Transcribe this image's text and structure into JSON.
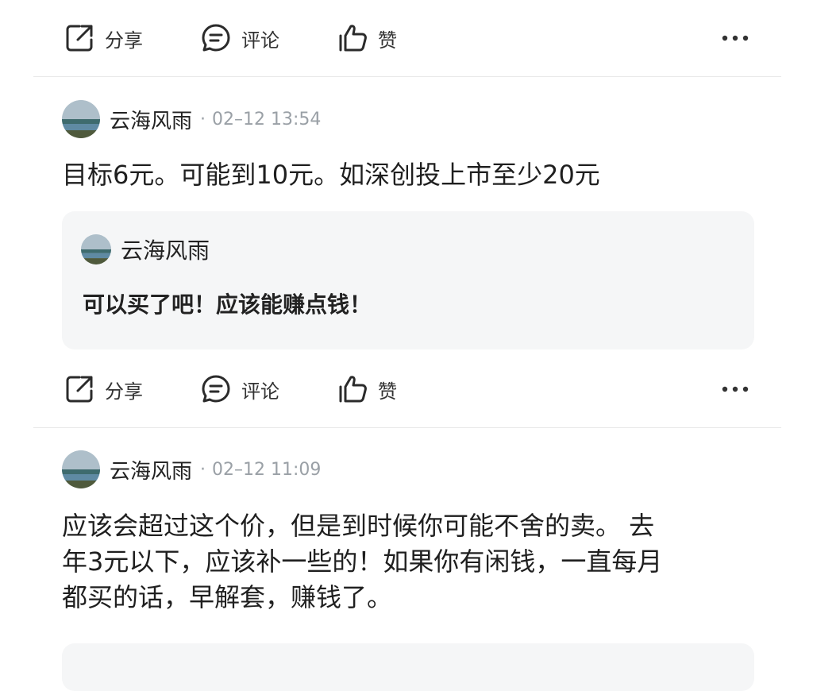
{
  "actions": {
    "share": "分享",
    "comment": "评论",
    "like": "赞"
  },
  "comments": [
    {
      "author": "云海风雨",
      "time": "02–12 13:54",
      "text": "目标6元。可能到10元。如深创投上市至少20元",
      "quote": {
        "author": "云海风雨",
        "text": "可以买了吧！应该能赚点钱！"
      }
    },
    {
      "author": "云海风雨",
      "time": "02–12 11:09",
      "text_lines": [
        "应该会超过这个价，但是到时候你可能不舍的卖。  去",
        "年3元以下，应该补一些的！如果你有闲钱，一直每月",
        "都买的话，早解套，赚钱了。"
      ]
    }
  ],
  "colors": {
    "text": "#1f1f1f",
    "meta": "#9aa0a6",
    "quote_bg": "#f5f6f7",
    "divider": "#e8e8e8"
  }
}
